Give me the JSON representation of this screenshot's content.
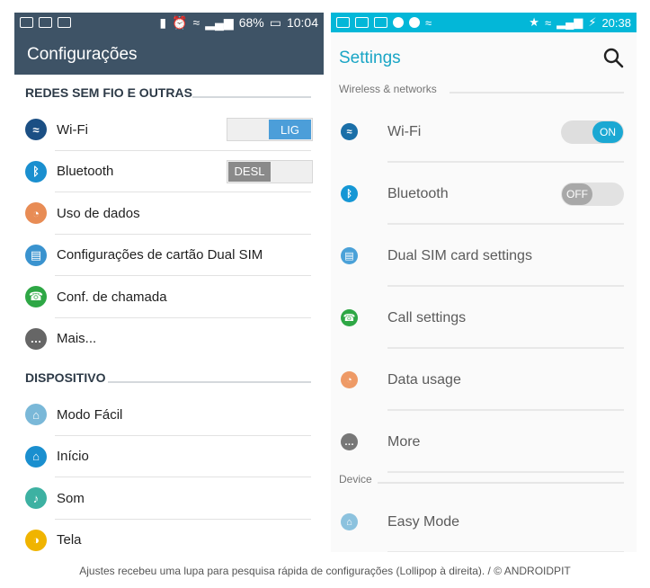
{
  "left_phone": {
    "status": {
      "battery": "68%",
      "time": "10:04"
    },
    "title": "Configurações",
    "sections": [
      {
        "title": "REDES SEM FIO E OUTRAS",
        "items": [
          {
            "label": "Wi-Fi",
            "icon": "wifi-icon",
            "color": "#1b4f84",
            "toggle": "LIG"
          },
          {
            "label": "Bluetooth",
            "icon": "bluetooth-icon",
            "color": "#1a8fcf",
            "toggle": "DESL"
          },
          {
            "label": "Uso de dados",
            "icon": "data-usage-icon",
            "color": "#e88c55"
          },
          {
            "label": "Configurações de cartão Dual SIM",
            "icon": "sim-card-icon",
            "color": "#3a93cf"
          },
          {
            "label": "Conf. de chamada",
            "icon": "phone-icon",
            "color": "#2ea745"
          },
          {
            "label": "Mais...",
            "icon": "more-icon",
            "color": "#666666"
          }
        ]
      },
      {
        "title": "DISPOSITIVO",
        "items": [
          {
            "label": "Modo Fácil",
            "icon": "easy-mode-icon",
            "color": "#7ab8d8"
          },
          {
            "label": "Início",
            "icon": "home-icon",
            "color": "#1a8fcf"
          },
          {
            "label": "Som",
            "icon": "sound-icon",
            "color": "#3db1a2"
          },
          {
            "label": "Tela",
            "icon": "display-icon",
            "color": "#f0b400"
          }
        ]
      }
    ]
  },
  "right_phone": {
    "status": {
      "time": "20:38"
    },
    "title": "Settings",
    "sections": [
      {
        "title": "Wireless & networks",
        "items": [
          {
            "label": "Wi-Fi",
            "icon": "wifi-icon",
            "color": "#1a6fa8",
            "toggle": "ON"
          },
          {
            "label": "Bluetooth",
            "icon": "bluetooth-icon",
            "color": "#1597d5",
            "toggle": "OFF"
          },
          {
            "label": "Dual SIM card settings",
            "icon": "sim-card-icon",
            "color": "#4aa1d8"
          },
          {
            "label": "Call settings",
            "icon": "phone-icon",
            "color": "#2ea745"
          },
          {
            "label": "Data usage",
            "icon": "data-usage-icon",
            "color": "#ee9a66"
          },
          {
            "label": "More",
            "icon": "more-icon",
            "color": "#777777"
          }
        ]
      },
      {
        "title": "Device",
        "items": [
          {
            "label": "Easy Mode",
            "icon": "easy-mode-icon",
            "color": "#8cc2de"
          }
        ]
      }
    ]
  },
  "caption": "Ajustes recebeu uma lupa para pesquisa rápida de configurações (Lollipop à direita). / © ANDROIDPIT"
}
